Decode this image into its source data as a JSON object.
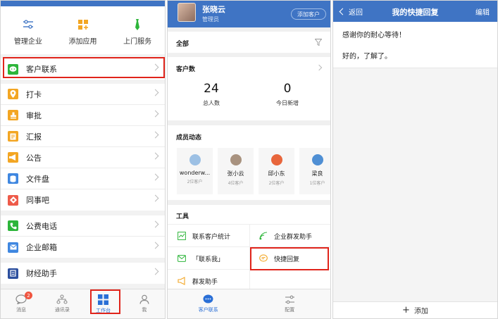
{
  "panel1": {
    "quick_actions": [
      {
        "label": "管理企业",
        "icon": "sliders-icon"
      },
      {
        "label": "添加应用",
        "icon": "add-app-icon"
      },
      {
        "label": "上门服务",
        "icon": "necktie-icon"
      }
    ],
    "customer_contact": {
      "label": "客户联系",
      "icon": "wechat-icon",
      "color": "#2db53a"
    },
    "apps": [
      {
        "label": "打卡",
        "icon": "location-icon",
        "color": "#f3a623"
      },
      {
        "label": "审批",
        "icon": "stamp-icon",
        "color": "#f3a623"
      },
      {
        "label": "汇报",
        "icon": "report-icon",
        "color": "#f3a623"
      },
      {
        "label": "公告",
        "icon": "megaphone-icon",
        "color": "#f3a623"
      },
      {
        "label": "文件盘",
        "icon": "disk-icon",
        "color": "#3f87e0"
      },
      {
        "label": "同事吧",
        "icon": "colleague-icon",
        "color": "#ee5b4a"
      }
    ],
    "apps2": [
      {
        "label": "公费电话",
        "icon": "phone-icon",
        "color": "#2db53a"
      },
      {
        "label": "企业邮箱",
        "icon": "mail-icon",
        "color": "#3f87e0"
      }
    ],
    "apps3": [
      {
        "label": "财经助手",
        "icon": "finance-icon",
        "color": "#2c4f9e"
      }
    ],
    "tabbar": [
      {
        "label": "消息",
        "icon": "chat-bubble-icon",
        "badge": "2"
      },
      {
        "label": "通讯录",
        "icon": "org-chart-icon"
      },
      {
        "label": "工作台",
        "icon": "grid-icon",
        "active": true
      },
      {
        "label": "我",
        "icon": "person-icon"
      }
    ]
  },
  "panel2": {
    "user": {
      "name": "张晓云",
      "role": "管理员",
      "add_customer": "添加客户"
    },
    "filter": {
      "label": "全部"
    },
    "stats": {
      "title": "客户数",
      "total_value": "24",
      "total_label": "总人数",
      "new_value": "0",
      "new_label": "今日新增"
    },
    "members": {
      "title": "成员动态",
      "list": [
        {
          "name": "wonderw...",
          "count": "2位客户",
          "color": "#9cc0e4"
        },
        {
          "name": "张小云",
          "count": "4位客户",
          "color": "#a8927f"
        },
        {
          "name": "邱小东",
          "count": "2位客户",
          "color": "#e8663c"
        },
        {
          "name": "梁良",
          "count": "1位客户",
          "color": "#4f8fd4"
        }
      ]
    },
    "tools": {
      "title": "工具",
      "items": [
        {
          "label": "联系客户统计",
          "icon": "chart-icon"
        },
        {
          "label": "企业群发助手",
          "icon": "signal-icon"
        },
        {
          "label": "「联系我」",
          "icon": "contact-me-icon"
        },
        {
          "label": "快捷回复",
          "icon": "quick-reply-icon"
        },
        {
          "label": "群发助手",
          "icon": "broadcast-icon"
        }
      ]
    },
    "tabbar": [
      {
        "label": "客户联系",
        "icon": "chat-bubble-icon",
        "active": true
      },
      {
        "label": "配置",
        "icon": "config-icon"
      }
    ]
  },
  "panel3": {
    "back_label": "返回",
    "title": "我的快捷回复",
    "edit_label": "编辑",
    "replies": [
      "感谢你的耐心等待！",
      "好的，了解了。"
    ],
    "add_label": "添加"
  },
  "colors": {
    "brand": "#3f74c4",
    "highlight": "#e0241b",
    "active_tab": "#2a6fd6"
  }
}
